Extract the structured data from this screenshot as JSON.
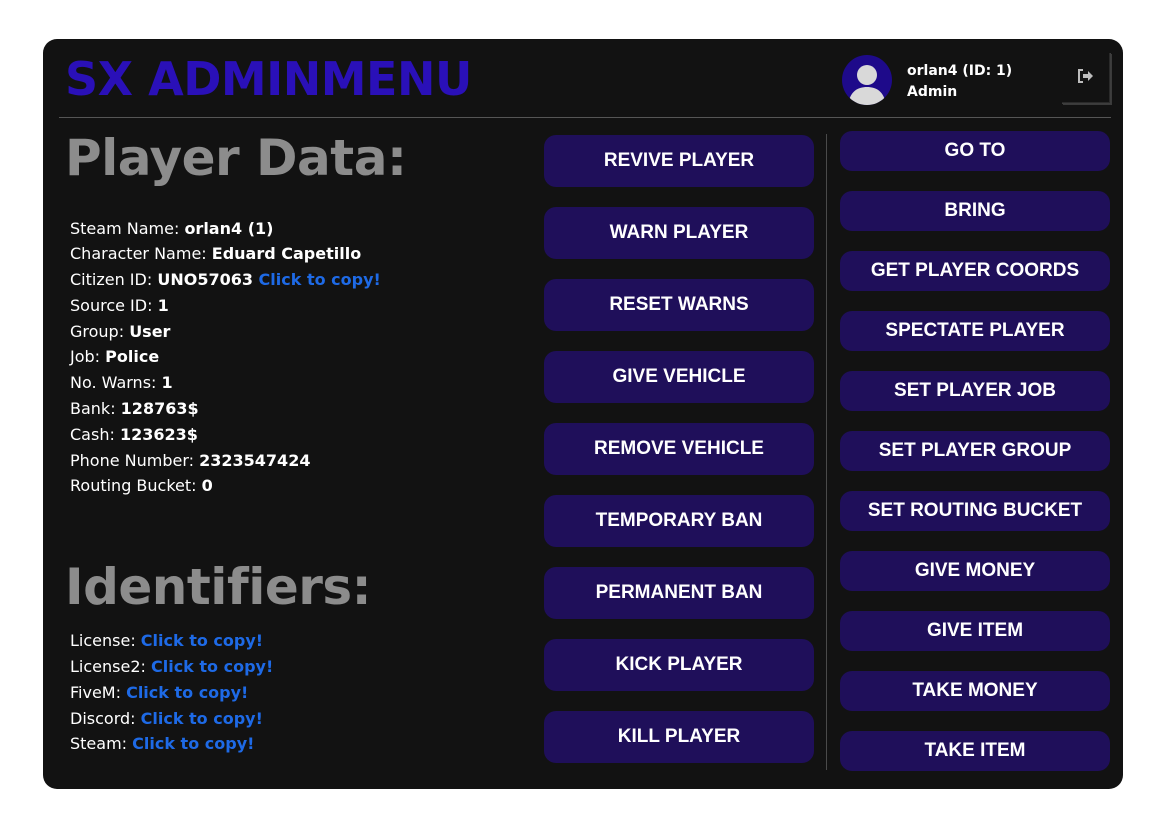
{
  "header": {
    "title": "SX ADMINMENU",
    "user_name": "orlan4 (ID: 1)",
    "user_role": "Admin"
  },
  "icons": {
    "avatar": "user-avatar-icon",
    "logout": "logout-icon"
  },
  "colors": {
    "panel_bg": "#121212",
    "title": "#2a10b8",
    "heading": "#8c8c8c",
    "link": "#1e6ae6",
    "button_bg": "#1f0f5a",
    "button_text": "#ffffff"
  },
  "player_data": {
    "heading": "Player Data:",
    "rows": [
      {
        "label": "Steam Name: ",
        "value": "orlan4 (1)",
        "link": ""
      },
      {
        "label": "Character Name: ",
        "value": "Eduard Capetillo",
        "link": ""
      },
      {
        "label": "Citizen ID: ",
        "value": "UNO57063 ",
        "link": "Click to copy!"
      },
      {
        "label": "Source ID: ",
        "value": "1",
        "link": ""
      },
      {
        "label": "Group: ",
        "value": "User",
        "link": ""
      },
      {
        "label": "Job: ",
        "value": "Police",
        "link": ""
      },
      {
        "label": "No. Warns: ",
        "value": "1",
        "link": ""
      },
      {
        "label": "Bank: ",
        "value": "128763$",
        "link": ""
      },
      {
        "label": "Cash: ",
        "value": "123623$",
        "link": ""
      },
      {
        "label": "Phone Number: ",
        "value": "2323547424",
        "link": ""
      },
      {
        "label": "Routing Bucket: ",
        "value": "0",
        "link": ""
      }
    ]
  },
  "identifiers": {
    "heading": "Identifiers:",
    "rows": [
      {
        "label": "License: ",
        "link": "Click to copy!"
      },
      {
        "label": "License2: ",
        "link": "Click to copy!"
      },
      {
        "label": "FiveM: ",
        "link": "Click to copy!"
      },
      {
        "label": "Discord: ",
        "link": "Click to copy!"
      },
      {
        "label": "Steam: ",
        "link": "Click to copy!"
      }
    ]
  },
  "actions_middle": [
    "REVIVE PLAYER",
    "WARN PLAYER",
    "RESET WARNS",
    "GIVE VEHICLE",
    "REMOVE VEHICLE",
    "TEMPORARY BAN",
    "PERMANENT BAN",
    "KICK PLAYER",
    "KILL PLAYER"
  ],
  "actions_right": [
    "GO TO",
    "BRING",
    "GET PLAYER COORDS",
    "SPECTATE PLAYER",
    "SET PLAYER JOB",
    "SET PLAYER GROUP",
    "SET ROUTING BUCKET",
    "GIVE MONEY",
    "GIVE ITEM",
    "TAKE MONEY",
    "TAKE ITEM"
  ]
}
